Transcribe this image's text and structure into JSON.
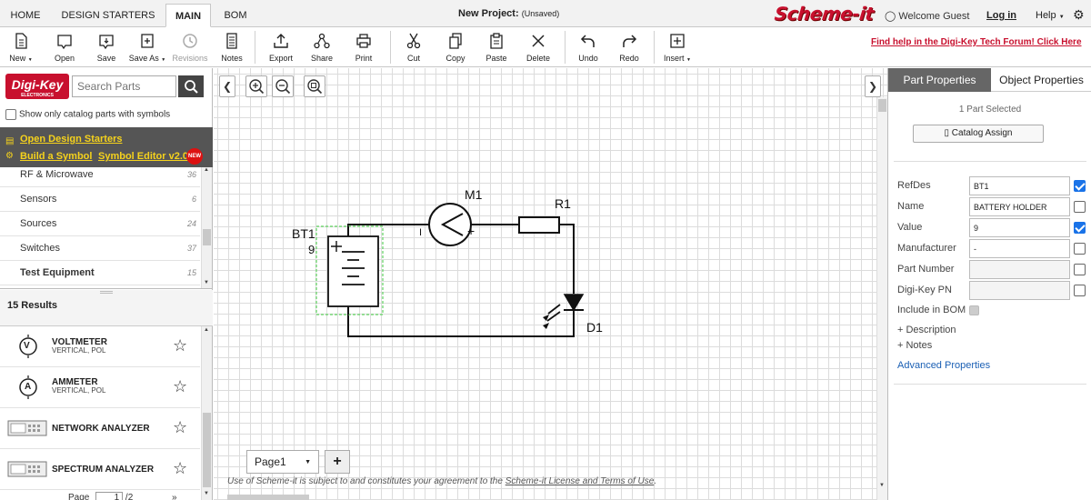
{
  "menu": {
    "tabs": [
      {
        "label": "HOME"
      },
      {
        "label": "DESIGN STARTERS"
      },
      {
        "label": "MAIN"
      },
      {
        "label": "BOM"
      }
    ],
    "project_title": "New Project:",
    "project_status": "(Unsaved)",
    "brand": "Scheme-it",
    "welcome": "Welcome Guest",
    "login": "Log in",
    "help": "Help"
  },
  "toolbar": {
    "buttons": [
      {
        "label": "New",
        "icon": "new-document-icon"
      },
      {
        "label": "Open",
        "icon": "open-folder-icon"
      },
      {
        "label": "Save",
        "icon": "save-icon"
      },
      {
        "label": "Save As",
        "icon": "save-as-icon"
      },
      {
        "label": "Revisions",
        "icon": "revisions-icon"
      },
      {
        "label": "Notes",
        "icon": "notes-icon"
      },
      {
        "label": "Export",
        "icon": "export-icon"
      },
      {
        "label": "Share",
        "icon": "share-icon"
      },
      {
        "label": "Print",
        "icon": "print-icon"
      },
      {
        "label": "Cut",
        "icon": "cut-icon"
      },
      {
        "label": "Copy",
        "icon": "copy-icon"
      },
      {
        "label": "Paste",
        "icon": "paste-icon"
      },
      {
        "label": "Delete",
        "icon": "delete-icon"
      },
      {
        "label": "Undo",
        "icon": "undo-icon"
      },
      {
        "label": "Redo",
        "icon": "redo-icon"
      },
      {
        "label": "Insert",
        "icon": "insert-icon"
      }
    ],
    "forum_link": "Find help in the Digi-Key Tech Forum! Click Here"
  },
  "left": {
    "logo": "Digi-Key",
    "logo_sub": "ELECTRONICS",
    "search_placeholder": "Search Parts",
    "catalog_only_label": "Show only catalog parts with symbols",
    "open_design_starters": "Open Design Starters",
    "build_symbol": "Build a Symbol",
    "symbol_editor": "Symbol Editor v2.0",
    "new_badge": "NEW",
    "categories": [
      {
        "name": "RF & Microwave",
        "count": "36"
      },
      {
        "name": "Sensors",
        "count": "6"
      },
      {
        "name": "Sources",
        "count": "24"
      },
      {
        "name": "Switches",
        "count": "37"
      },
      {
        "name": "Test Equipment",
        "count": "15"
      }
    ],
    "results_count": "15 Results",
    "results": [
      {
        "name": "VOLTMETER",
        "sub": "VERTICAL, POL",
        "icon": "voltmeter-icon",
        "symbol": "V"
      },
      {
        "name": "AMMETER",
        "sub": "VERTICAL, POL",
        "icon": "ammeter-icon",
        "symbol": "A"
      },
      {
        "name": "NETWORK ANALYZER",
        "sub": "",
        "icon": "network-analyzer-icon"
      },
      {
        "name": "SPECTRUM ANALYZER",
        "sub": "",
        "icon": "spectrum-analyzer-icon"
      }
    ],
    "pager_label": "Page",
    "pager_value": "1",
    "pager_total": "/2",
    "pager_next": "»"
  },
  "canvas": {
    "components": {
      "bt1_ref": "BT1",
      "bt1_value": "9",
      "m1_ref": "M1",
      "r1_ref": "R1",
      "d1_ref": "D1",
      "meter_minus": "I",
      "meter_plus": "+"
    },
    "page_tab": "Page1",
    "add_page": "+",
    "terms_prefix": "Use of Scheme-it is subject to and constitutes your agreement to the ",
    "terms_link": "Scheme-it License and Terms of Use",
    "terms_suffix": "."
  },
  "right": {
    "tab_part": "Part Properties",
    "tab_object": "Object Properties",
    "selected": "1 Part Selected",
    "catalog_assign": "Catalog Assign",
    "props": [
      {
        "label": "RefDes",
        "value": "BT1",
        "checked": true
      },
      {
        "label": "Name",
        "value": "BATTERY HOLDER",
        "checked": false
      },
      {
        "label": "Value",
        "value": "9",
        "checked": true
      },
      {
        "label": "Manufacturer",
        "value": "-",
        "checked": false
      },
      {
        "label": "Part Number",
        "value": "",
        "checked": false
      },
      {
        "label": "Digi-Key PN",
        "value": "",
        "checked": false
      }
    ],
    "include_bom": "Include in BOM",
    "description": "+ Description",
    "notes": "+ Notes",
    "advanced": "Advanced Properties"
  }
}
